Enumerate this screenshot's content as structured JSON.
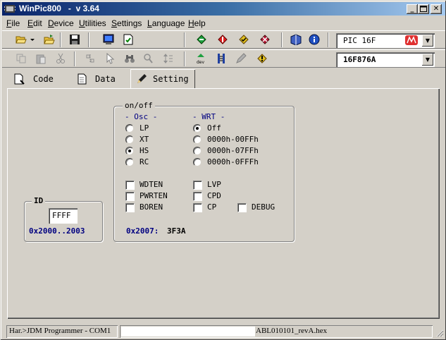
{
  "window": {
    "title": "WinPic800   -  v 3.64",
    "minimize": "_",
    "restore": "□",
    "close": "✕"
  },
  "menu": [
    {
      "label": "File",
      "u": "F",
      "rest": "ile"
    },
    {
      "label": "Edit",
      "u": "E",
      "rest": "dit"
    },
    {
      "label": "Device",
      "u": "D",
      "rest": "evice"
    },
    {
      "label": "Utilities",
      "u": "U",
      "rest": "tilities"
    },
    {
      "label": "Settings",
      "u": "S",
      "rest": "ettings"
    },
    {
      "label": "Language",
      "u": "L",
      "rest": "anguage"
    },
    {
      "label": "Help",
      "u": "H",
      "rest": "elp"
    }
  ],
  "toolbar": {
    "device_family": "PIC 16F",
    "device_model": "16F876A",
    "dropdown_glyph": "▼"
  },
  "tabs": [
    {
      "label": "Code",
      "icon": "code-page-icon",
      "active": false
    },
    {
      "label": "Data",
      "icon": "data-page-icon",
      "active": false
    },
    {
      "label": "Setting",
      "icon": "setting-pen-icon",
      "active": true
    }
  ],
  "config": {
    "onoff_title": "on/off",
    "osc_header": "- Osc -",
    "wrt_header": "- WRT -",
    "osc_options": [
      {
        "label": "LP",
        "selected": false
      },
      {
        "label": "XT",
        "selected": false
      },
      {
        "label": "HS",
        "selected": true
      },
      {
        "label": "RC",
        "selected": false
      }
    ],
    "wrt_options": [
      {
        "label": "Off",
        "selected": true
      },
      {
        "label": "0000h-00FFh",
        "selected": false
      },
      {
        "label": "0000h-07FFh",
        "selected": false
      },
      {
        "label": "0000h-0FFFh",
        "selected": false
      }
    ],
    "checks_left": [
      {
        "label": "WDTEN",
        "checked": false
      },
      {
        "label": "PWRTEN",
        "checked": false
      },
      {
        "label": "BOREN",
        "checked": false
      }
    ],
    "checks_mid": [
      {
        "label": "LVP",
        "checked": false
      },
      {
        "label": "CPD",
        "checked": false
      },
      {
        "label": "CP",
        "checked": false
      }
    ],
    "check_debug": {
      "label": "DEBUG",
      "checked": false
    },
    "config_addr": "0x2007:",
    "config_value": "3F3A"
  },
  "id_box": {
    "title": "ID",
    "value": "FFFF",
    "range": "0x2000..2003"
  },
  "status": {
    "hardware": "Har.>JDM Programmer - COM1",
    "file": "ABL010101_revA.hex"
  }
}
